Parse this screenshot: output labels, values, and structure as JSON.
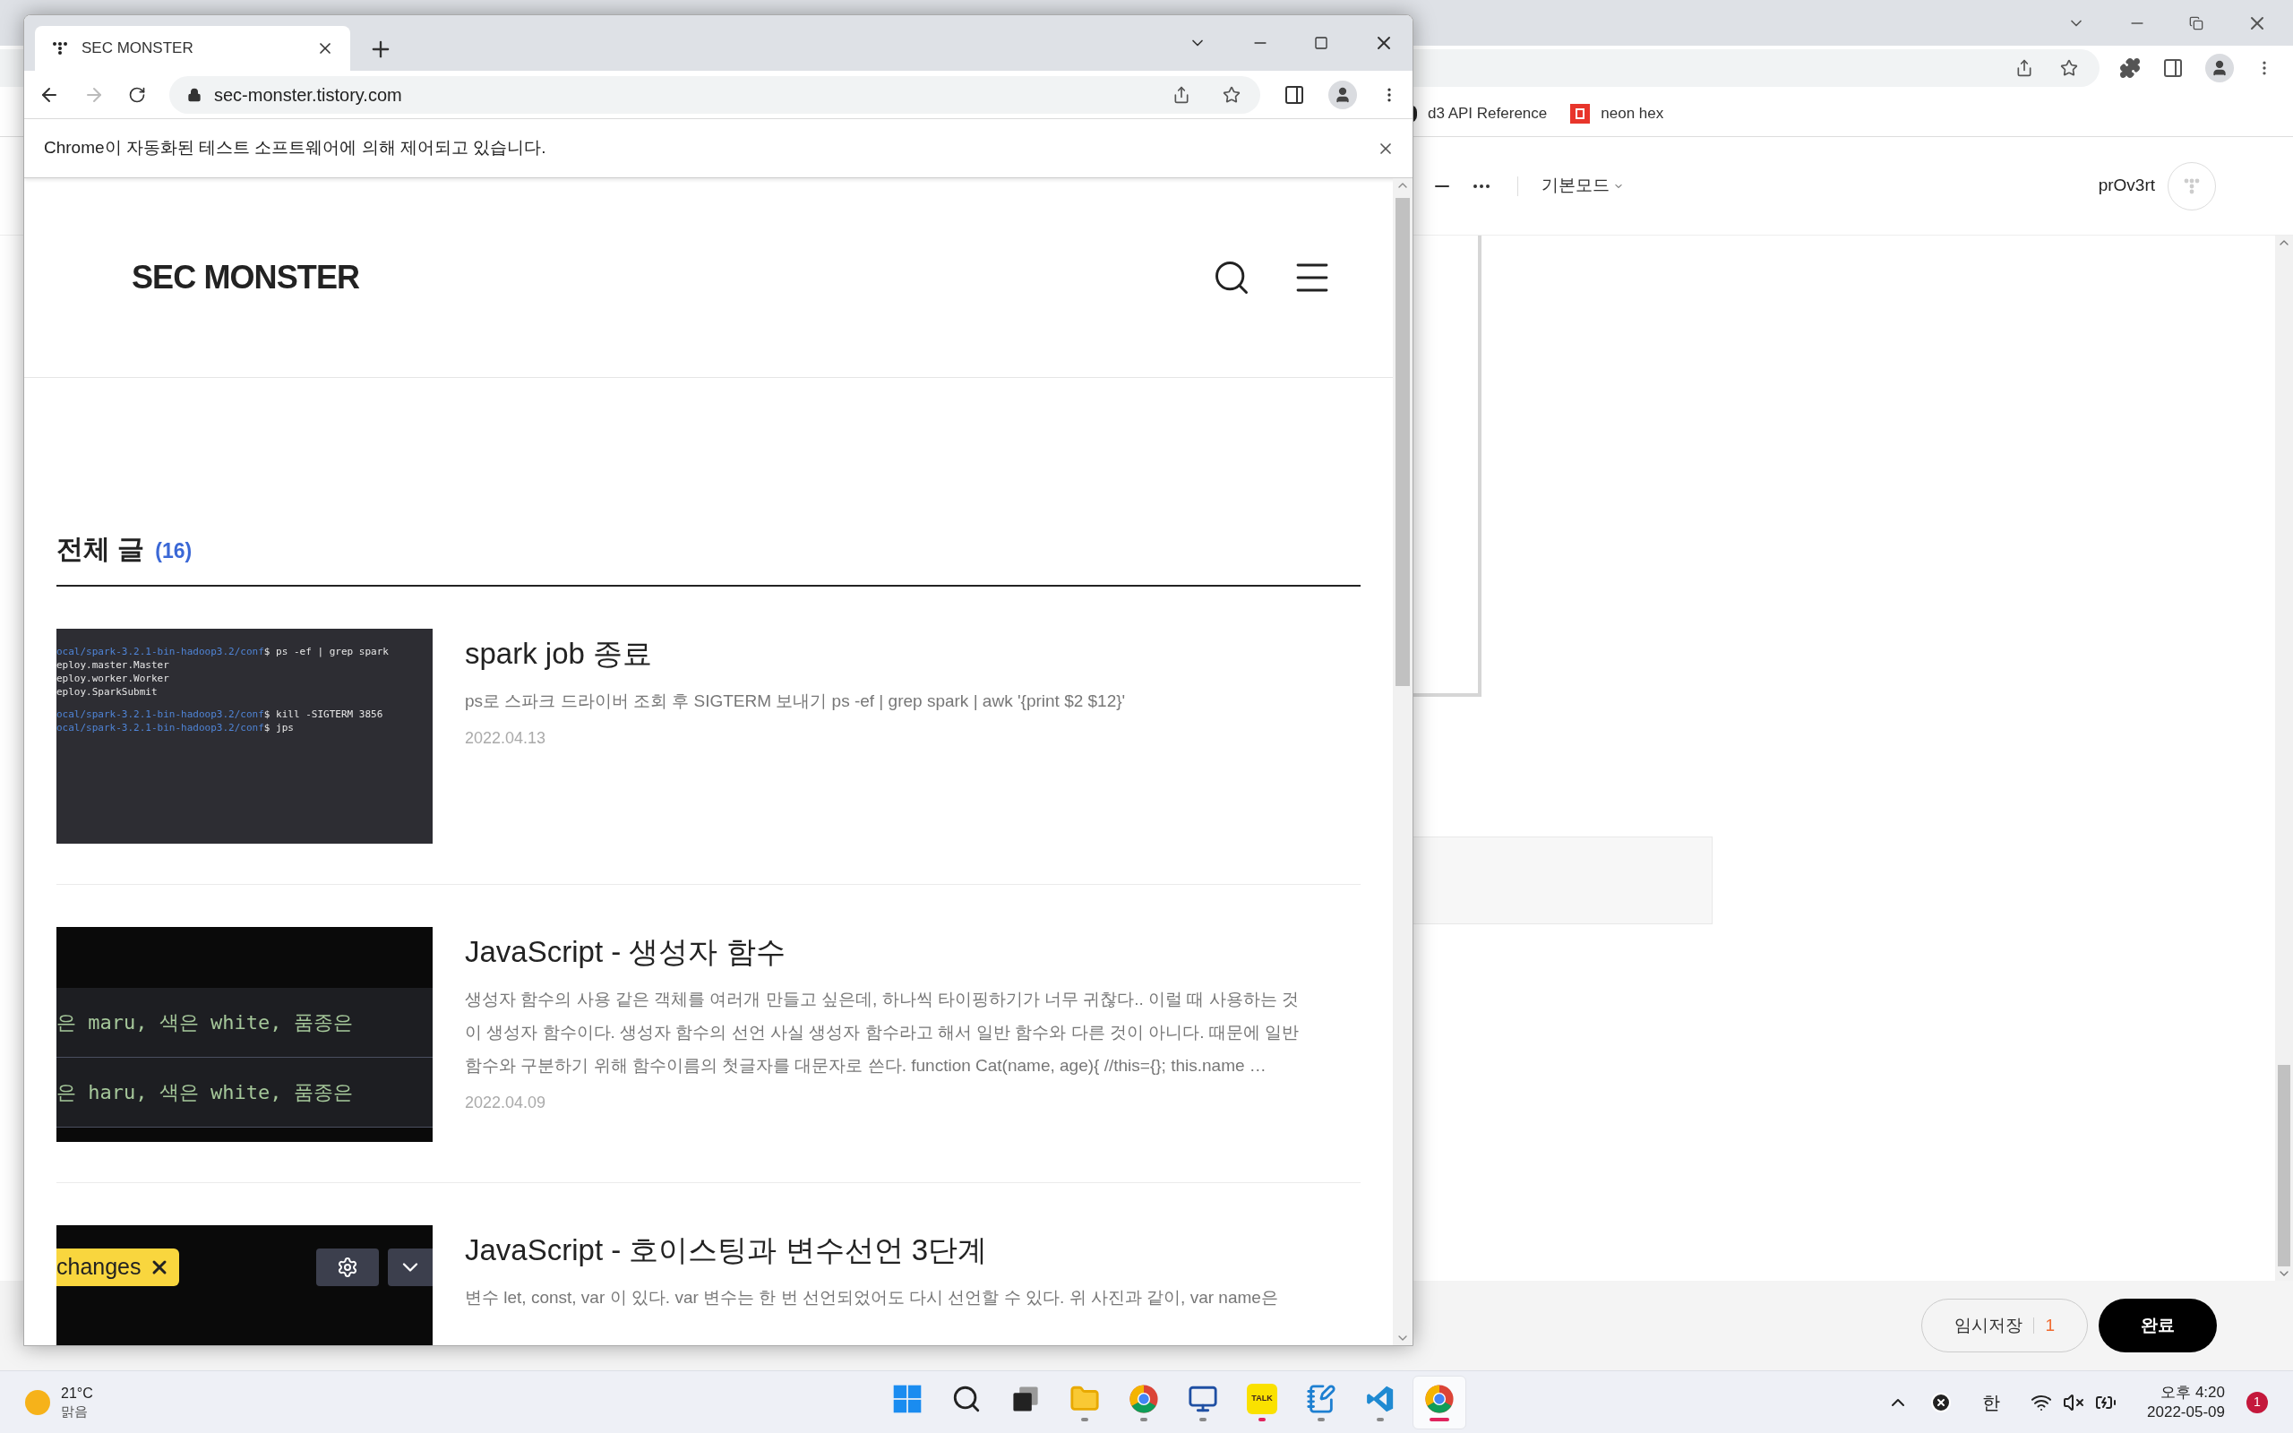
{
  "background_window": {
    "bookmarks": [
      {
        "label": "d3 API Reference",
        "kind": "d3"
      },
      {
        "label": "neon hex",
        "kind": "neon"
      }
    ],
    "editor": {
      "mode_label": "기본모드",
      "username": "prOv3rt",
      "draft_button": "임시저장",
      "draft_count": "1",
      "done_button": "완료"
    }
  },
  "browser": {
    "tab_title": "SEC MONSTER",
    "url": "sec-monster.tistory.com",
    "forward_enabled": false,
    "infobar": "Chrome이 자동화된 테스트 소프트웨어에 의해 제어되고 있습니다.",
    "blog": {
      "logo": "SEC MONSTER",
      "section_title": "전체 글",
      "post_count": "(16)",
      "posts": [
        {
          "title": "spark job 종료",
          "summary": "ps로 스파크 드라이버 조회 후 SIGTERM 보내기 ps -ef | grep spark | awk '{print $2 $12}'",
          "date": "2022.04.13",
          "thumbnail": {
            "kind": "terminal",
            "blocks": [
              [
                {
                  "prompt": "ocal/spark-3.2.1-bin-hadoop3.2/conf",
                  "text": "$ ps -ef | grep spark"
                },
                {
                  "text": "eploy.master.Master"
                },
                {
                  "text": "eploy.worker.Worker"
                },
                {
                  "text": "eploy.SparkSubmit"
                }
              ],
              [
                {
                  "prompt": "ocal/spark-3.2.1-bin-hadoop3.2/conf",
                  "text": "$ kill -SIGTERM 3856"
                },
                {
                  "prompt": "ocal/spark-3.2.1-bin-hadoop3.2/conf",
                  "text": "$ jps"
                }
              ]
            ]
          }
        },
        {
          "title": "JavaScript - 생성자 함수",
          "summary": "생성자 함수의 사용 같은 객체를 여러개 만들고 싶은데, 하나씩 타이핑하기가 너무 귀찮다.. 이럴 때 사용하는 것이 생성자 함수이다. 생성자 함수의 선언 사실 생성자 함수라고 해서 일반 함수와 다른 것이 아니다. 때문에 일반 함수와 구분하기 위해 함수이름의 첫글자를 대문자로 쓴다. function Cat(name, age){ //this={}; this.name …",
          "date": "2022.04.09",
          "thumbnail": {
            "kind": "code",
            "lines": [
              "은 maru, 색은 white, 품종은",
              "은 haru, 색은 white, 품종은"
            ]
          }
        },
        {
          "title": "JavaScript - 호이스팅과 변수선언 3단계",
          "summary": "변수 let, const, var 이 있다. var 변수는 한 번 선언되었어도 다시 선언할 수 있다. 위 사진과 같이, var name은",
          "thumbnail": {
            "kind": "toolbar",
            "chip": "changes"
          }
        }
      ]
    }
  },
  "taskbar": {
    "weather": {
      "temperature": "21°C",
      "condition": "맑음"
    },
    "apps": [
      {
        "kind": "start",
        "running": false,
        "selected": false
      },
      {
        "kind": "search",
        "running": false,
        "selected": false
      },
      {
        "kind": "task-view",
        "running": false,
        "selected": false
      },
      {
        "kind": "folder",
        "running": true,
        "alert": false,
        "selected": false
      },
      {
        "kind": "chrome",
        "running": true,
        "alert": false,
        "selected": false
      },
      {
        "kind": "remote",
        "running": true,
        "alert": false,
        "selected": false
      },
      {
        "kind": "talk",
        "label": "TALK",
        "running": true,
        "alert": true,
        "selected": false
      },
      {
        "kind": "notepad",
        "running": true,
        "alert": false,
        "selected": false
      },
      {
        "kind": "code",
        "running": true,
        "alert": false,
        "selected": false
      },
      {
        "kind": "chrome",
        "running": true,
        "alert": false,
        "selected": true
      }
    ],
    "ime": "한",
    "time": "오후 4:20",
    "date": "2022-05-09",
    "notifications": "1"
  }
}
